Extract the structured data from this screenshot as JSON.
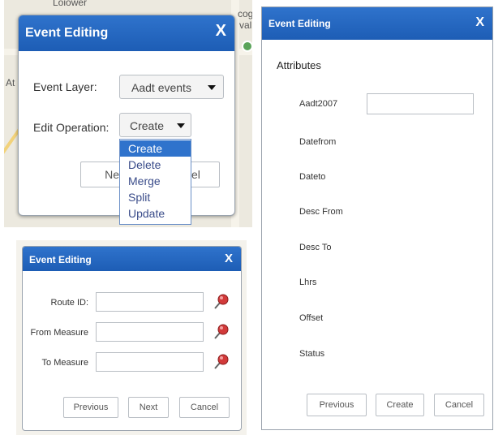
{
  "dialog1": {
    "title": "Event Editing",
    "close": "X",
    "event_layer_label": "Event Layer:",
    "event_layer_value": "Aadt events",
    "edit_operation_label": "Edit Operation:",
    "edit_operation_value": "Create",
    "next_partial": "Nex",
    "cancel_partial": "el",
    "menu_items": [
      "Create",
      "Delete",
      "Merge",
      "Split",
      "Update"
    ],
    "map_labels": {
      "top": "Loiower",
      "right": "cog\nval",
      "left": "At"
    }
  },
  "dialog2": {
    "title": "Event Editing",
    "close": "X",
    "route_id_label": "Route ID:",
    "from_measure_label": "From Measure",
    "to_measure_label": "To Measure",
    "previous": "Previous",
    "next": "Next",
    "cancel": "Cancel"
  },
  "dialog3": {
    "title": "Event Editing",
    "close": "X",
    "section": "Attributes",
    "fields": [
      "Aadt2007",
      "Datefrom",
      "Dateto",
      "Desc From",
      "Desc To",
      "Lhrs",
      "Offset",
      "Status"
    ],
    "previous": "Previous",
    "create": "Create",
    "cancel": "Cancel"
  },
  "icons": {
    "pin": "pushpin-icon",
    "caret": "chevron-down-icon"
  },
  "colors": {
    "titlebar": "#2f73cc",
    "menu_selected": "#2f73cc",
    "pin": "#d23a3a"
  }
}
